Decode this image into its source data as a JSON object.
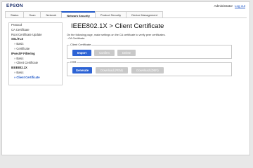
{
  "header": {
    "logo": "EPSON",
    "user": "Administrator",
    "logout": "Log out"
  },
  "tabs": [
    {
      "label": "Status"
    },
    {
      "label": "Scan"
    },
    {
      "label": "Network"
    },
    {
      "label": "Network Security",
      "active": true
    },
    {
      "label": "Product Security"
    },
    {
      "label": "Device Management"
    }
  ],
  "sidebar": {
    "items": [
      {
        "label": "Protocol"
      },
      {
        "label": "CA Certificate"
      },
      {
        "label": "Root Certificate Update"
      },
      {
        "label": "SSL/TLS"
      },
      {
        "label": "Basic"
      },
      {
        "label": "Certificate"
      },
      {
        "label": "IPsec/IP Filtering"
      },
      {
        "label": "Basic"
      },
      {
        "label": "Client Certificate"
      },
      {
        "label": "IEEE802.1X"
      },
      {
        "label": "Basic"
      },
      {
        "label": "Client Certificate"
      }
    ],
    "arrow": "»"
  },
  "main": {
    "title": "IEEE802.1X > Client Certificate",
    "description_line1": "On the following page, make settings on the CA certificate to verify peer certificates.",
    "description_line2": "- CA Certificate",
    "client_certificate": {
      "legend": "Client Certificate",
      "import": "Import",
      "confirm": "Confirm",
      "delete": "Delete"
    },
    "csr": {
      "legend": "CSR",
      "generate": "Generate",
      "download_pem": "Download (PEM)",
      "download_der": "Download (DER)"
    }
  },
  "colors": {
    "accent": "#2d63d4",
    "link": "#1f57c7",
    "disabled": "#c9c9c9"
  }
}
